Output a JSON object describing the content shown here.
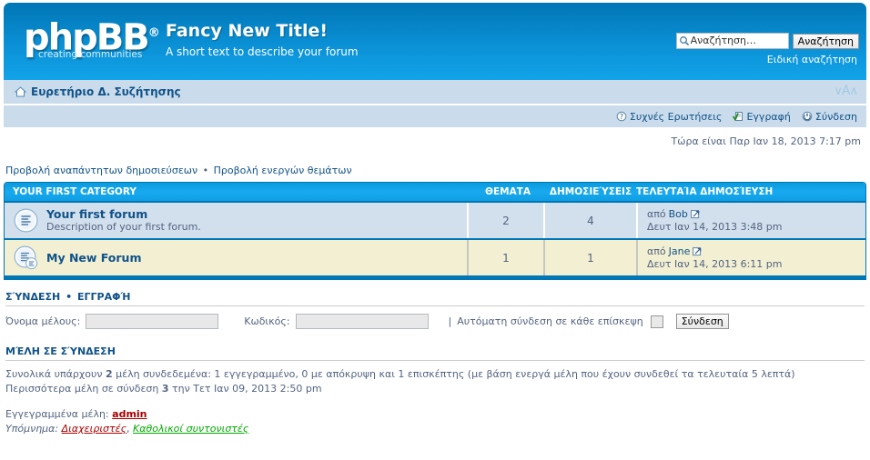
{
  "header": {
    "logo_main": "phpBB",
    "logo_reg": "®",
    "logo_sub": "creating communities",
    "site_title": "Fancy New Title!",
    "site_description": "A short text to describe your forum",
    "search_placeholder": "Αναζήτηση…",
    "search_value": "",
    "search_button": "Αναζήτηση",
    "advanced_search": "Ειδική αναζήτηση"
  },
  "navbar": {
    "breadcrumb": "Ευρετήριο Δ. Συζήτησης",
    "fontsize_small": "∨",
    "fontsize_a": "A",
    "fontsize_large": "∧",
    "links": [
      {
        "label": "Συχνές Ερωτήσεις",
        "icon": "faq-icon"
      },
      {
        "label": "Εγγραφή",
        "icon": "register-icon"
      },
      {
        "label": "Σύνδεση",
        "icon": "login-icon"
      }
    ]
  },
  "timebar": {
    "current_time": "Τώρα είναι Παρ Ιαν 18, 2013 7:17 pm"
  },
  "action_links": {
    "unanswered": "Προβολή αναπάντητων δημοσιεύσεων",
    "separator": "•",
    "active_topics": "Προβολή ενεργών θεμάτων"
  },
  "forum_table": {
    "category": "YOUR FIRST CATEGORY",
    "columns": {
      "topics": "ΘΕΜΑΤΑ",
      "posts": "ΔΗΜΟΣΙΕΎΣΕΙΣ",
      "last_post": "ΤΕΛΕΥΤΑΊΑ ΔΗΜΟΣΊΕΥΣΗ"
    },
    "rows": [
      {
        "name": "Your first forum",
        "description": "Description of your first forum.",
        "topics": "2",
        "posts": "4",
        "last_author_prefix": "από",
        "last_author": "Bob",
        "last_date": "Δευτ Ιαν 14, 2013 3:48 pm",
        "icon": "forum-read-icon"
      },
      {
        "name": "My New Forum",
        "description": "",
        "topics": "1",
        "posts": "1",
        "last_author_prefix": "από",
        "last_author": "Jane",
        "last_date": "Δευτ Ιαν 14, 2013 6:11 pm",
        "icon": "forum-read-subforum-icon"
      }
    ]
  },
  "login_section": {
    "title_login": "ΣΎΝΔΕΣΗ",
    "title_separator": "•",
    "title_register": "ΕΓΓΡΑΦΉ",
    "username_label": "Όνομα μέλους:",
    "username_value": "",
    "password_label": "Κωδικός:",
    "password_value": "",
    "pipe": "|",
    "autologin_label": "Αυτόματη σύνδεση σε κάθε επίσκεψη",
    "login_button": "Σύνδεση"
  },
  "online_section": {
    "title": "ΜΈΛΗ ΣΕ ΣΎΝΔΕΣΗ",
    "stats_part1": "Συνολικά υπάρχουν",
    "stats_total": "2",
    "stats_part2": "μέλη συνδεδεμένα: 1 εγγεγραμμένο, 0 με απόκρυψη και 1 επισκέπτης (με βάση ενεργά μέλη που έχουν συνδεθεί τα τελευταία 5 λεπτά)",
    "record_part1": "Περισσότερα μέλη σε σύνδεση",
    "record_count": "3",
    "record_part2": "την Τετ Ιαν 09, 2013 2:50 pm",
    "registered_label": "Εγγεγραμμένα μέλη:",
    "registered_users": "admin",
    "legend_label": "Υπόμνημα:",
    "legend_admins": "Διαχειριστές",
    "legend_comma": ",",
    "legend_gmods": "Καθολικοί συντονιστές"
  },
  "colors": {
    "header_top": "#0076b5",
    "header_bottom": "#12a3e8",
    "navbar": "#cadceb",
    "row1_bg": "#d2dfec",
    "row2_bg": "#f2efd2",
    "link": "#105289",
    "text": "#536482",
    "admin": "#AA0000",
    "gmod": "#00AA00"
  }
}
